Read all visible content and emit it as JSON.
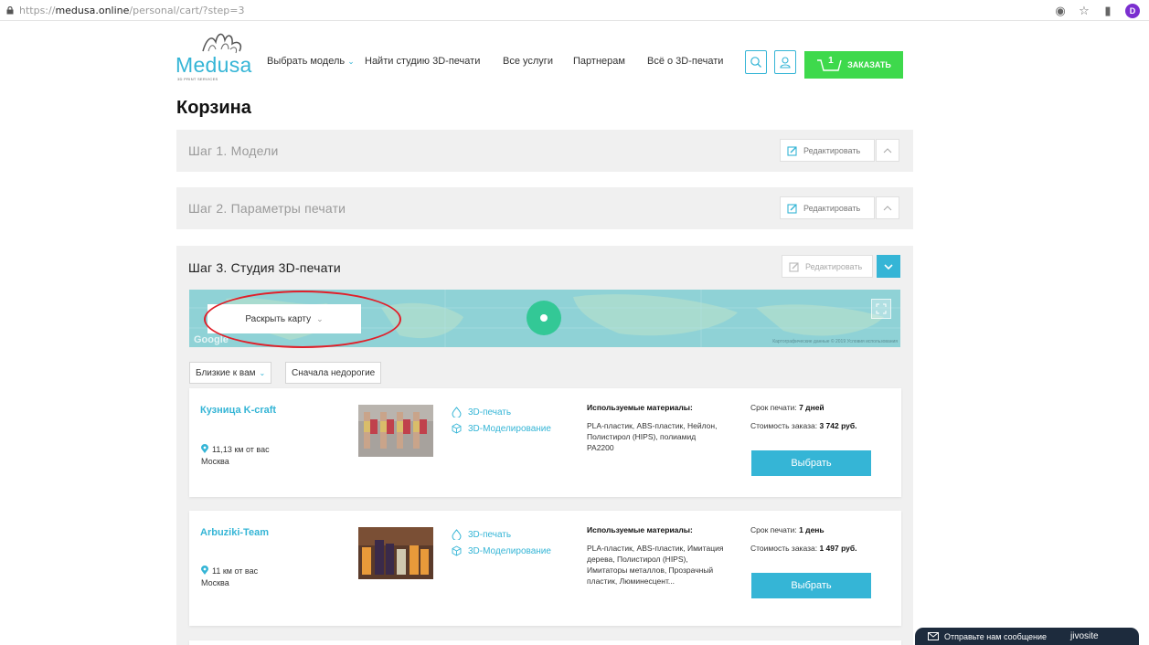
{
  "browser": {
    "url_scheme": "https://",
    "url_domain": "medusa.online",
    "url_path": "/personal/cart/?step=3",
    "profile_initial": "D"
  },
  "header": {
    "logo_text": "Medusa",
    "logo_sub": "3D PRINT SERVICES",
    "nav": [
      {
        "label": "Выбрать модель",
        "has_caret": true
      },
      {
        "label": "Найти студию 3D-печати"
      },
      {
        "label": "Все услуги"
      },
      {
        "label": "Партнерам"
      },
      {
        "label": "Всё о 3D-печати"
      }
    ],
    "cart_count": "1",
    "order_label": "ЗАКАЗАТЬ"
  },
  "page_title": "Корзина",
  "steps": [
    {
      "title": "Шаг 1. Модели",
      "edit_label": "Редактировать"
    },
    {
      "title": "Шаг 2. Параметры печати",
      "edit_label": "Редактировать"
    },
    {
      "title": "Шаг 3. Студия 3D-печати",
      "edit_label": "Редактировать"
    }
  ],
  "map": {
    "reveal_label": "Раскрыть карту",
    "google_label": "Google",
    "attribution": "Картографические данные © 2019   Условия использования"
  },
  "sort": {
    "near_label": "Близкие к вам",
    "cheap_label": "Сначала недорогие"
  },
  "studios": [
    {
      "name": "Кузница K-craft",
      "distance": "11,13 км от вас",
      "city": "Москва",
      "services": [
        "3D-печать",
        "3D-Моделирование"
      ],
      "materials_title": "Используемые материалы:",
      "materials": "PLA-пластик, ABS-пластик, Нейлон, Полистирол (HIPS), полиамид PA2200",
      "term_label": "Срок печати:",
      "term_value": "7 дней",
      "price_label": "Стоимость заказа:",
      "price_value": "3 742 руб.",
      "choose_label": "Выбрать"
    },
    {
      "name": "Arbuziki-Team",
      "distance": "11 км от вас",
      "city": "Москва",
      "services": [
        "3D-печать",
        "3D-Моделирование"
      ],
      "materials_title": "Используемые материалы:",
      "materials": "PLA-пластик, ABS-пластик, Имитация дерева, Полистирол (HIPS), Имитаторы металлов, Прозрачный пластик, Люминесцент...",
      "term_label": "Срок печати:",
      "term_value": "1 день",
      "price_label": "Стоимость заказа:",
      "price_value": "1 497 руб.",
      "choose_label": "Выбрать"
    }
  ],
  "chat": {
    "label": "Отправьте нам сообщение",
    "brand": "jivosite"
  },
  "colors": {
    "accent": "#35b5d6",
    "order_green": "#3ed94c",
    "highlight_red": "#e0202a"
  }
}
